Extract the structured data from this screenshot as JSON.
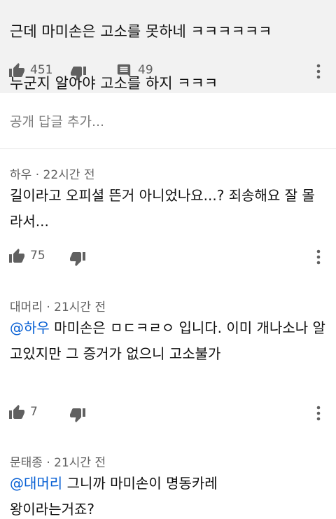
{
  "top_comment": {
    "lines": [
      "근데 마미손은 고소를 못하네 ㅋㅋㅋㅋㅋㅋ",
      "누군지 알아야 고소를 하지 ㅋㅋㅋ"
    ],
    "like_count": "451",
    "reply_count": "49"
  },
  "add_reply": {
    "placeholder": "공개 답글 추가..."
  },
  "replies": [
    {
      "author": "하우",
      "time": "22시간 전",
      "mention": "",
      "text": "길이라고 오피셜 뜬거 아니었나요...? 죄송해요 잘 몰라서...",
      "like_count": "75"
    },
    {
      "author": "대머리",
      "time": "21시간 전",
      "mention": "@하우",
      "text": "마미손은 ㅁㄷㅋㄹㅇ 입니다. 이미 개나소나 알고있지만 그 증거가 없으니 고소불가",
      "like_count": "7"
    },
    {
      "author": "문태종",
      "time": "21시간 전",
      "mention": "@대머리",
      "text": "그니까 마미손이 명동카레왕이라는거죠?",
      "like_count": ""
    }
  ],
  "meta_separator": "·",
  "icons": {
    "like": "thumbs-up-icon",
    "dislike": "thumbs-down-icon",
    "reply": "reply-comment-icon",
    "more": "more-vert-icon"
  },
  "colors": {
    "mention": "#065fd4",
    "secondary_text": "#606060",
    "icon": "#606060",
    "highlight_bg": "#f2f2f2"
  }
}
